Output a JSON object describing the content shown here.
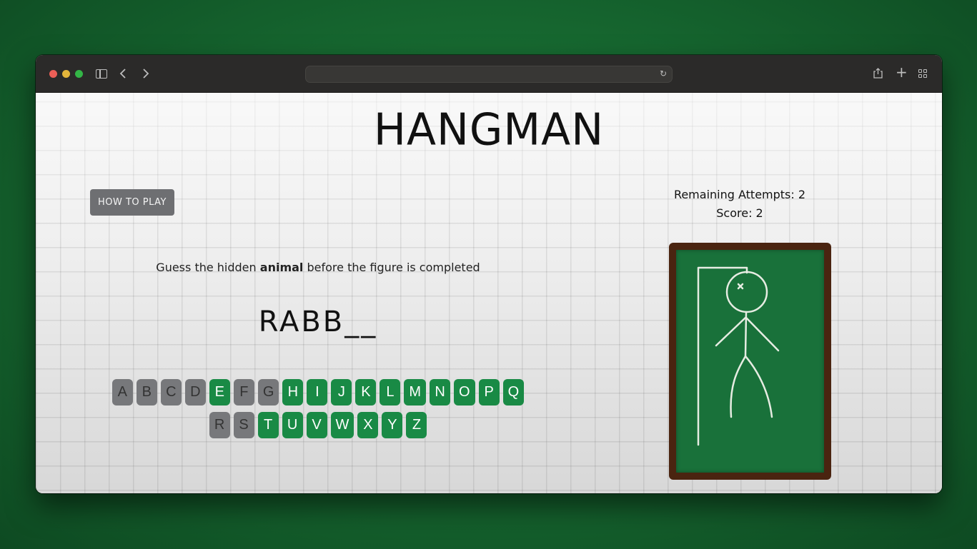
{
  "browser": {
    "url": "",
    "icons": [
      "sidebar-icon",
      "back-icon",
      "forward-icon",
      "reload-icon",
      "share-icon",
      "new-tab-icon",
      "tab-overview-icon"
    ]
  },
  "game": {
    "title": "HANGMAN",
    "how_to_play_label": "HOW TO PLAY",
    "remaining_attempts_text": "Remaining Attempts: 2",
    "score_text": "Score: 2",
    "instruction_prefix": "Guess the hidden",
    "instruction_category": "animal",
    "instruction_suffix": "before the figure is completed",
    "word_display": "RABB__",
    "keyboard": {
      "row1": [
        {
          "letter": "A",
          "state": "used"
        },
        {
          "letter": "B",
          "state": "used"
        },
        {
          "letter": "C",
          "state": "used"
        },
        {
          "letter": "D",
          "state": "used"
        },
        {
          "letter": "E",
          "state": "available"
        },
        {
          "letter": "F",
          "state": "used"
        },
        {
          "letter": "G",
          "state": "used"
        },
        {
          "letter": "H",
          "state": "available"
        },
        {
          "letter": "I",
          "state": "available"
        },
        {
          "letter": "J",
          "state": "available"
        },
        {
          "letter": "K",
          "state": "available"
        },
        {
          "letter": "L",
          "state": "available"
        },
        {
          "letter": "M",
          "state": "available"
        },
        {
          "letter": "N",
          "state": "available"
        },
        {
          "letter": "O",
          "state": "available"
        },
        {
          "letter": "P",
          "state": "available"
        },
        {
          "letter": "Q",
          "state": "available"
        }
      ],
      "row2": [
        {
          "letter": "R",
          "state": "used"
        },
        {
          "letter": "S",
          "state": "used"
        },
        {
          "letter": "T",
          "state": "available"
        },
        {
          "letter": "U",
          "state": "available"
        },
        {
          "letter": "V",
          "state": "available"
        },
        {
          "letter": "W",
          "state": "available"
        },
        {
          "letter": "X",
          "state": "available"
        },
        {
          "letter": "Y",
          "state": "available"
        },
        {
          "letter": "Z",
          "state": "available"
        }
      ]
    },
    "figure_parts_drawn": [
      "gallows",
      "head",
      "eye-x",
      "body",
      "left-arm",
      "right-arm",
      "left-leg",
      "right-leg"
    ]
  },
  "colors": {
    "used_key": "#77787b",
    "available_key": "#198a45",
    "board": "#19713a",
    "board_frame": "#4a2410",
    "chalk": "#e6ece2"
  }
}
